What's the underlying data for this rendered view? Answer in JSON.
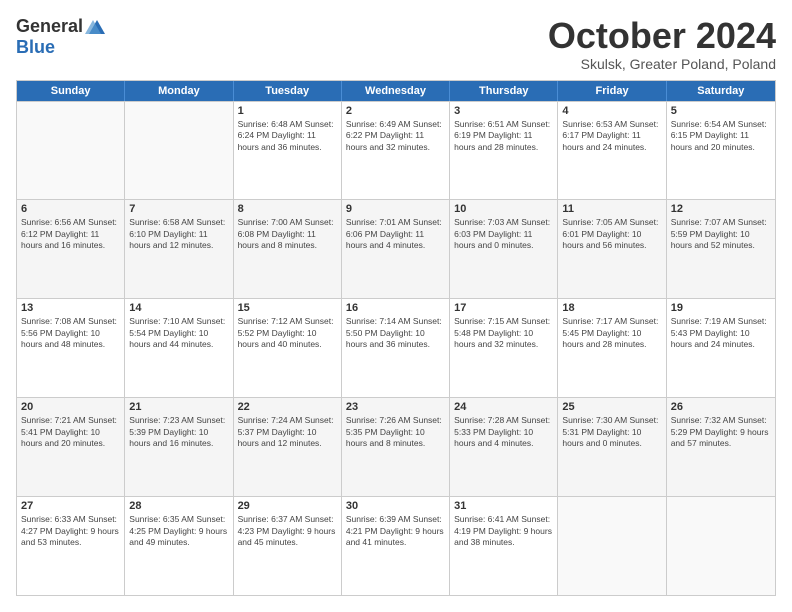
{
  "header": {
    "logo_general": "General",
    "logo_blue": "Blue",
    "month_title": "October 2024",
    "subtitle": "Skulsk, Greater Poland, Poland"
  },
  "days_of_week": [
    "Sunday",
    "Monday",
    "Tuesday",
    "Wednesday",
    "Thursday",
    "Friday",
    "Saturday"
  ],
  "weeks": [
    [
      {
        "day": "",
        "info": ""
      },
      {
        "day": "",
        "info": ""
      },
      {
        "day": "1",
        "info": "Sunrise: 6:48 AM\nSunset: 6:24 PM\nDaylight: 11 hours\nand 36 minutes."
      },
      {
        "day": "2",
        "info": "Sunrise: 6:49 AM\nSunset: 6:22 PM\nDaylight: 11 hours\nand 32 minutes."
      },
      {
        "day": "3",
        "info": "Sunrise: 6:51 AM\nSunset: 6:19 PM\nDaylight: 11 hours\nand 28 minutes."
      },
      {
        "day": "4",
        "info": "Sunrise: 6:53 AM\nSunset: 6:17 PM\nDaylight: 11 hours\nand 24 minutes."
      },
      {
        "day": "5",
        "info": "Sunrise: 6:54 AM\nSunset: 6:15 PM\nDaylight: 11 hours\nand 20 minutes."
      }
    ],
    [
      {
        "day": "6",
        "info": "Sunrise: 6:56 AM\nSunset: 6:12 PM\nDaylight: 11 hours\nand 16 minutes."
      },
      {
        "day": "7",
        "info": "Sunrise: 6:58 AM\nSunset: 6:10 PM\nDaylight: 11 hours\nand 12 minutes."
      },
      {
        "day": "8",
        "info": "Sunrise: 7:00 AM\nSunset: 6:08 PM\nDaylight: 11 hours\nand 8 minutes."
      },
      {
        "day": "9",
        "info": "Sunrise: 7:01 AM\nSunset: 6:06 PM\nDaylight: 11 hours\nand 4 minutes."
      },
      {
        "day": "10",
        "info": "Sunrise: 7:03 AM\nSunset: 6:03 PM\nDaylight: 11 hours\nand 0 minutes."
      },
      {
        "day": "11",
        "info": "Sunrise: 7:05 AM\nSunset: 6:01 PM\nDaylight: 10 hours\nand 56 minutes."
      },
      {
        "day": "12",
        "info": "Sunrise: 7:07 AM\nSunset: 5:59 PM\nDaylight: 10 hours\nand 52 minutes."
      }
    ],
    [
      {
        "day": "13",
        "info": "Sunrise: 7:08 AM\nSunset: 5:56 PM\nDaylight: 10 hours\nand 48 minutes."
      },
      {
        "day": "14",
        "info": "Sunrise: 7:10 AM\nSunset: 5:54 PM\nDaylight: 10 hours\nand 44 minutes."
      },
      {
        "day": "15",
        "info": "Sunrise: 7:12 AM\nSunset: 5:52 PM\nDaylight: 10 hours\nand 40 minutes."
      },
      {
        "day": "16",
        "info": "Sunrise: 7:14 AM\nSunset: 5:50 PM\nDaylight: 10 hours\nand 36 minutes."
      },
      {
        "day": "17",
        "info": "Sunrise: 7:15 AM\nSunset: 5:48 PM\nDaylight: 10 hours\nand 32 minutes."
      },
      {
        "day": "18",
        "info": "Sunrise: 7:17 AM\nSunset: 5:45 PM\nDaylight: 10 hours\nand 28 minutes."
      },
      {
        "day": "19",
        "info": "Sunrise: 7:19 AM\nSunset: 5:43 PM\nDaylight: 10 hours\nand 24 minutes."
      }
    ],
    [
      {
        "day": "20",
        "info": "Sunrise: 7:21 AM\nSunset: 5:41 PM\nDaylight: 10 hours\nand 20 minutes."
      },
      {
        "day": "21",
        "info": "Sunrise: 7:23 AM\nSunset: 5:39 PM\nDaylight: 10 hours\nand 16 minutes."
      },
      {
        "day": "22",
        "info": "Sunrise: 7:24 AM\nSunset: 5:37 PM\nDaylight: 10 hours\nand 12 minutes."
      },
      {
        "day": "23",
        "info": "Sunrise: 7:26 AM\nSunset: 5:35 PM\nDaylight: 10 hours\nand 8 minutes."
      },
      {
        "day": "24",
        "info": "Sunrise: 7:28 AM\nSunset: 5:33 PM\nDaylight: 10 hours\nand 4 minutes."
      },
      {
        "day": "25",
        "info": "Sunrise: 7:30 AM\nSunset: 5:31 PM\nDaylight: 10 hours\nand 0 minutes."
      },
      {
        "day": "26",
        "info": "Sunrise: 7:32 AM\nSunset: 5:29 PM\nDaylight: 9 hours\nand 57 minutes."
      }
    ],
    [
      {
        "day": "27",
        "info": "Sunrise: 6:33 AM\nSunset: 4:27 PM\nDaylight: 9 hours\nand 53 minutes."
      },
      {
        "day": "28",
        "info": "Sunrise: 6:35 AM\nSunset: 4:25 PM\nDaylight: 9 hours\nand 49 minutes."
      },
      {
        "day": "29",
        "info": "Sunrise: 6:37 AM\nSunset: 4:23 PM\nDaylight: 9 hours\nand 45 minutes."
      },
      {
        "day": "30",
        "info": "Sunrise: 6:39 AM\nSunset: 4:21 PM\nDaylight: 9 hours\nand 41 minutes."
      },
      {
        "day": "31",
        "info": "Sunrise: 6:41 AM\nSunset: 4:19 PM\nDaylight: 9 hours\nand 38 minutes."
      },
      {
        "day": "",
        "info": ""
      },
      {
        "day": "",
        "info": ""
      }
    ]
  ]
}
